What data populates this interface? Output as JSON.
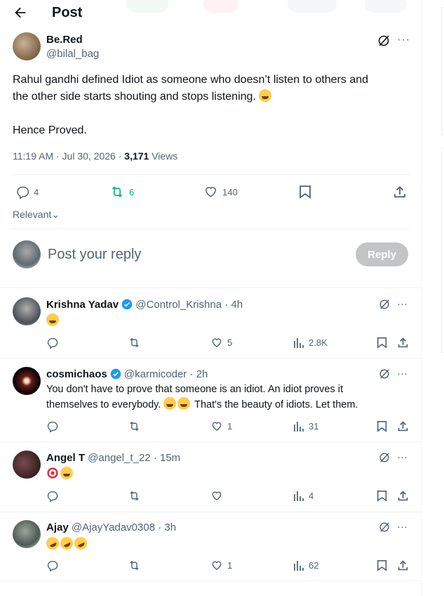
{
  "header": {
    "title": "Post"
  },
  "post": {
    "author_name": "Be.Red",
    "author_handle": "@bilal_bag",
    "line1": "Rahul gandhi defined Idiot as someone who doesn’t listen to others and",
    "line2": "the other side starts shouting and stops listening.",
    "line3": "Hence Proved.",
    "timestamp": "11:19 AM · Jul 30, 2026 · ",
    "views_count": "3,171",
    "views_label": " Views",
    "replies": "4",
    "reposts": "6",
    "likes": "140",
    "repost_color": "#00ba7c"
  },
  "sort": {
    "label": "Relevant"
  },
  "composer": {
    "placeholder": "Post your reply",
    "button": "Reply"
  },
  "replies": [
    {
      "name": "Krishna Yadav",
      "verified": true,
      "handle": "@Control_Krishna",
      "time": "· 4h",
      "line1": "",
      "line2": "",
      "emojis": [
        "tears"
      ],
      "likes": "5",
      "views": "2.8K"
    },
    {
      "name": "cosmichaos",
      "verified": true,
      "handle": "@karmicoder",
      "time": "· 2h",
      "line1": "You don't have to prove that someone is an idiot. An idiot proves it",
      "line2": "themselves to everybody.",
      "line2b": "That's the beauty of idiots. Let them.",
      "emojis": [
        "sweat",
        "tears"
      ],
      "likes": "1",
      "views": "31"
    },
    {
      "name": "Angel T",
      "verified": false,
      "handle": "@angel_t_22",
      "time": "· 15m",
      "emojis": [
        "target",
        "tears"
      ],
      "likes": "",
      "views": "4"
    },
    {
      "name": "Ajay",
      "verified": false,
      "handle": "@AjayYadav0308",
      "time": "· 3h",
      "emojis": [
        "rofl",
        "rofl",
        "rofl"
      ],
      "likes": "1",
      "views": "62"
    }
  ]
}
